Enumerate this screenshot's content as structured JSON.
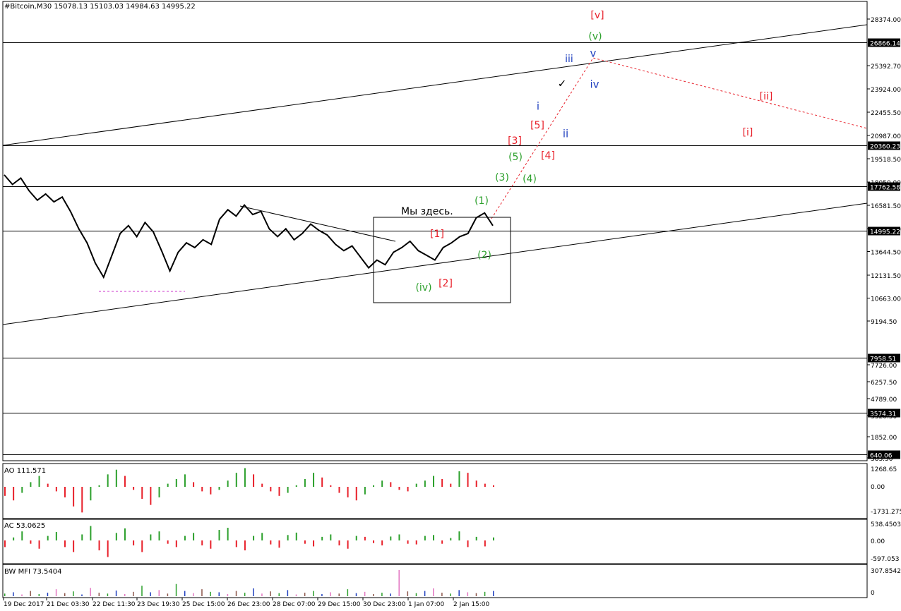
{
  "title": "#Bitcoin,M30  15078.13 15103.03 14984.63 14995.22",
  "annotation": "Мы здесь.",
  "chart_data": [
    {
      "type": "line",
      "name": "main",
      "title": "#Bitcoin,M30  15078.13 15103.03 14984.63 14995.22",
      "ohlc_last": {
        "open": 15078.13,
        "high": 15103.03,
        "low": 14984.63,
        "close": 14995.22
      },
      "ylim": [
        7958.51,
        28374.0
      ],
      "y_ticks": [
        28374.0,
        25392.7,
        23924.0,
        22455.5,
        20987.0,
        19518.5,
        18050.0,
        16581.5,
        15113.0,
        13644.5,
        12131.5,
        10663.0,
        9194.5,
        7726.0,
        6257.5,
        4789.0,
        3320.5,
        1852.0,
        383.5
      ],
      "y_tick_labels": [
        "28374.00",
        "25392.70",
        "23924.00",
        "22455.50",
        "20987.00",
        "19518.50",
        "18050.00",
        "16581.50",
        "15113.00",
        "13644.50",
        "12131.50",
        "10663.00",
        "9194.50",
        "7726.00",
        "6257.50",
        "4789.00",
        "3320.50",
        "1852.00",
        "383.50"
      ],
      "h_levels": [
        {
          "value": 26866.14,
          "label": "26866.14"
        },
        {
          "value": 20360.23,
          "label": "20360.23"
        },
        {
          "value": 17762.58,
          "label": "17762.58"
        },
        {
          "value": 14995.22,
          "label": "14995.22"
        },
        {
          "value": 7958.51,
          "label": "7958.51"
        },
        {
          "value": 3574.31,
          "label": "3574.31"
        },
        {
          "value": 640.06,
          "label": "640.06"
        }
      ],
      "x_labels": [
        "19 Dec 2017",
        "21 Dec 03:30",
        "22 Dec 11:30",
        "23 Dec 19:30",
        "25 Dec 15:00",
        "26 Dec 23:00",
        "28 Dec 07:00",
        "29 Dec 15:00",
        "30 Dec 23:00",
        "1 Jan 07:00",
        "2 Jan 15:00"
      ],
      "price_series": [
        18500,
        17900,
        18300,
        17500,
        16900,
        17300,
        16800,
        17100,
        16200,
        15100,
        14200,
        12900,
        12000,
        13400,
        14800,
        15300,
        14600,
        15500,
        14900,
        13700,
        12400,
        13600,
        14200,
        13900,
        14400,
        14100,
        15700,
        16300,
        15900,
        16600,
        16000,
        16200,
        15100,
        14600,
        15100,
        14400,
        14800,
        15400,
        15000,
        14700,
        14100,
        13700,
        14000,
        13300,
        12600,
        13100,
        12800,
        13600,
        13900,
        14300,
        13700,
        13400,
        13100,
        13900,
        14200,
        14600,
        14800,
        15800,
        16100,
        15300
      ],
      "elliott_labels": [
        {
          "text": "[v]",
          "color": "red"
        },
        {
          "text": "(v)",
          "color": "green"
        },
        {
          "text": "iii",
          "color": "blue"
        },
        {
          "text": "v",
          "color": "blue"
        },
        {
          "text": "iv",
          "color": "blue"
        },
        {
          "text": "i",
          "color": "blue"
        },
        {
          "text": "ii",
          "color": "blue"
        },
        {
          "text": "[5]",
          "color": "red"
        },
        {
          "text": "[3]",
          "color": "red"
        },
        {
          "text": "[4]",
          "color": "red"
        },
        {
          "text": "(5)",
          "color": "green"
        },
        {
          "text": "(3)",
          "color": "green"
        },
        {
          "text": "(4)",
          "color": "green"
        },
        {
          "text": "(1)",
          "color": "green"
        },
        {
          "text": "[1]",
          "color": "red"
        },
        {
          "text": "(2)",
          "color": "green"
        },
        {
          "text": "(iv)",
          "color": "green"
        },
        {
          "text": "[2]",
          "color": "red"
        },
        {
          "text": "[ii]",
          "color": "red"
        },
        {
          "text": "[i]",
          "color": "red"
        },
        {
          "text": "✓",
          "color": "black"
        }
      ]
    },
    {
      "type": "bar",
      "name": "AO",
      "label": "AO 111.571",
      "value": 111.571,
      "y_tick_labels": [
        "1268.65",
        "0.00",
        "-1731.275"
      ],
      "ylim": [
        -1731.275,
        1268.65
      ],
      "colors": {
        "up": "#2ca02c",
        "down": "#e8202a"
      },
      "values": [
        -600,
        -900,
        -400,
        300,
        700,
        200,
        -300,
        -700,
        -1300,
        -1700,
        -900,
        100,
        800,
        1100,
        700,
        -200,
        -800,
        -1200,
        -700,
        200,
        500,
        800,
        300,
        -300,
        -500,
        -200,
        400,
        900,
        1200,
        800,
        200,
        -300,
        -600,
        -400,
        100,
        500,
        900,
        600,
        100,
        -400,
        -700,
        -900,
        -500,
        100,
        400,
        300,
        -200,
        -300,
        200,
        400,
        700,
        500,
        200,
        1000,
        900,
        400,
        200,
        100
      ]
    },
    {
      "type": "bar",
      "name": "AC",
      "label": "AC 53.0625",
      "value": 53.0625,
      "y_tick_labels": [
        "538.4503",
        "0.00",
        "-597.053"
      ],
      "ylim": [
        -597.053,
        538.4503
      ],
      "colors": {
        "up": "#2ca02c",
        "down": "#e8202a"
      },
      "values": [
        -200,
        100,
        300,
        -100,
        -250,
        150,
        280,
        -200,
        -350,
        200,
        480,
        -300,
        -500,
        250,
        400,
        -150,
        -350,
        200,
        300,
        -100,
        -200,
        150,
        250,
        -150,
        -250,
        350,
        420,
        -200,
        -300,
        150,
        250,
        -120,
        -220,
        180,
        260,
        -100,
        -180,
        120,
        200,
        -150,
        -250,
        150,
        120,
        -80,
        -150,
        130,
        200,
        -100,
        -120,
        150,
        180,
        -100,
        80,
        300,
        -200,
        120,
        -180,
        100
      ]
    },
    {
      "type": "bar",
      "name": "BW MFI",
      "label": "BW MFI 73.5404",
      "value": 73.5404,
      "y_tick_labels": [
        "307.8542",
        "0"
      ],
      "ylim": [
        0,
        307.8542
      ],
      "colors": {
        "green": "#2ca02c",
        "blue": "#1f3fbf",
        "pink": "#e377c2",
        "brown": "#8c564b"
      },
      "values": [
        30,
        45,
        20,
        60,
        25,
        40,
        80,
        35,
        55,
        20,
        95,
        40,
        30,
        65,
        25,
        50,
        120,
        45,
        70,
        30,
        140,
        60,
        35,
        80,
        50,
        45,
        25,
        60,
        40,
        90,
        30,
        55,
        35,
        70,
        20,
        40,
        60,
        25,
        45,
        30,
        80,
        35,
        50,
        25,
        40,
        30,
        300,
        55,
        35,
        60,
        90,
        40,
        30,
        70,
        45,
        35,
        50,
        60
      ]
    }
  ]
}
